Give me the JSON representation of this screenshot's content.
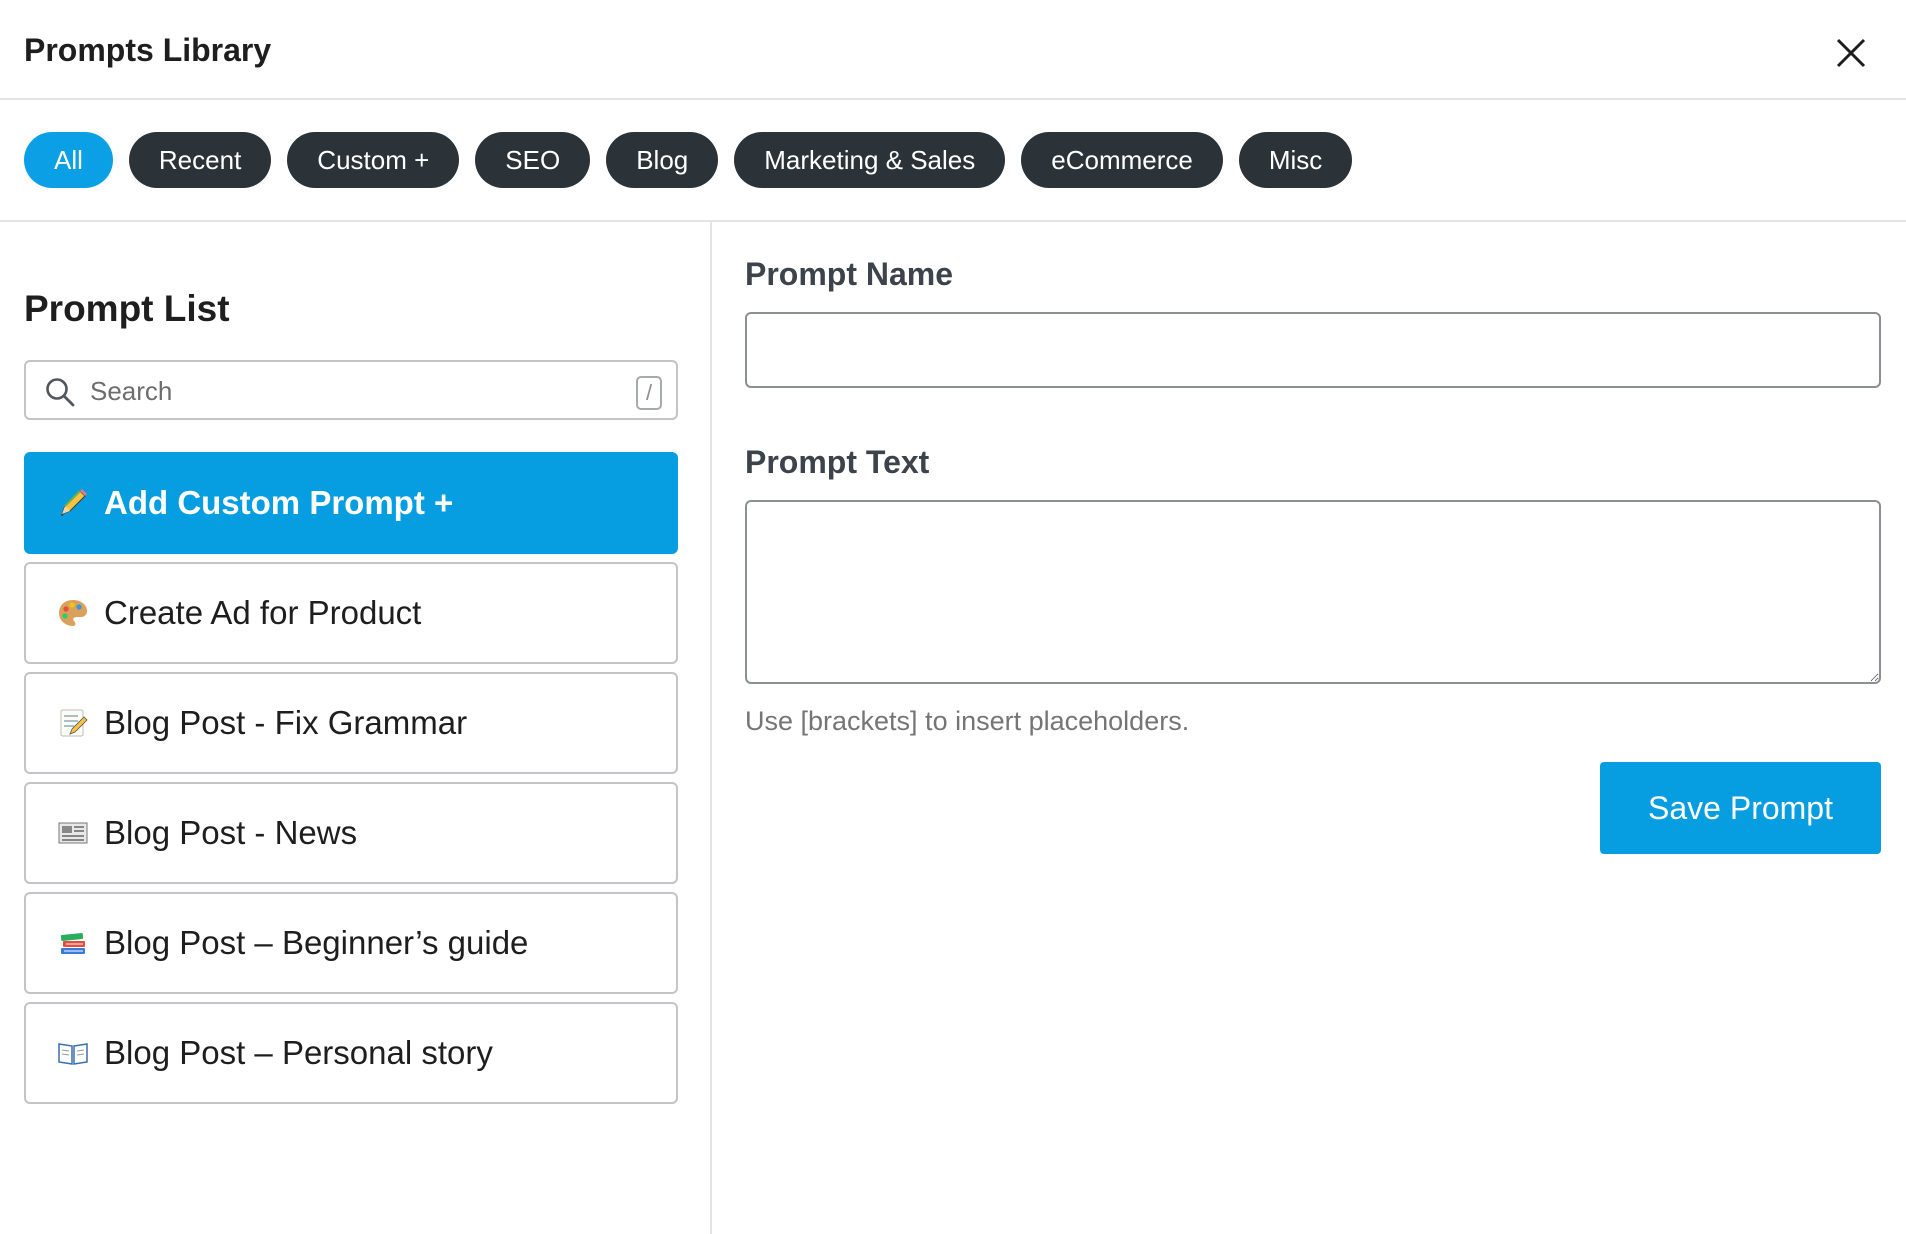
{
  "dialog": {
    "title": "Prompts Library"
  },
  "tabs": [
    {
      "label": "All",
      "active": true
    },
    {
      "label": "Recent"
    },
    {
      "label": "Custom +"
    },
    {
      "label": "SEO"
    },
    {
      "label": "Blog"
    },
    {
      "label": "Marketing & Sales"
    },
    {
      "label": "eCommerce"
    },
    {
      "label": "Misc"
    }
  ],
  "prompt_list": {
    "heading": "Prompt List",
    "search": {
      "placeholder": "Search",
      "value": "",
      "shortcut": "/"
    },
    "items": [
      {
        "label": "Add Custom Prompt +",
        "icon": "pencil-icon"
      },
      {
        "label": "Create Ad for Product",
        "icon": "palette-icon"
      },
      {
        "label": "Blog Post - Fix Grammar",
        "icon": "memo-icon"
      },
      {
        "label": "Blog Post - News",
        "icon": "newspaper-icon"
      },
      {
        "label": "Blog Post – Beginner’s guide",
        "icon": "books-icon"
      },
      {
        "label": "Blog Post – Personal story",
        "icon": "open-book-icon"
      }
    ]
  },
  "editor": {
    "name_label": "Prompt Name",
    "name_value": "",
    "text_label": "Prompt Text",
    "text_value": "",
    "hint": "Use [brackets] to insert placeholders.",
    "save_label": "Save Prompt"
  },
  "colors": {
    "accent": "#069ee0",
    "tab_active": "#0ba0e6",
    "tab_inactive": "#2c3338",
    "border": "#c3c4c7"
  }
}
